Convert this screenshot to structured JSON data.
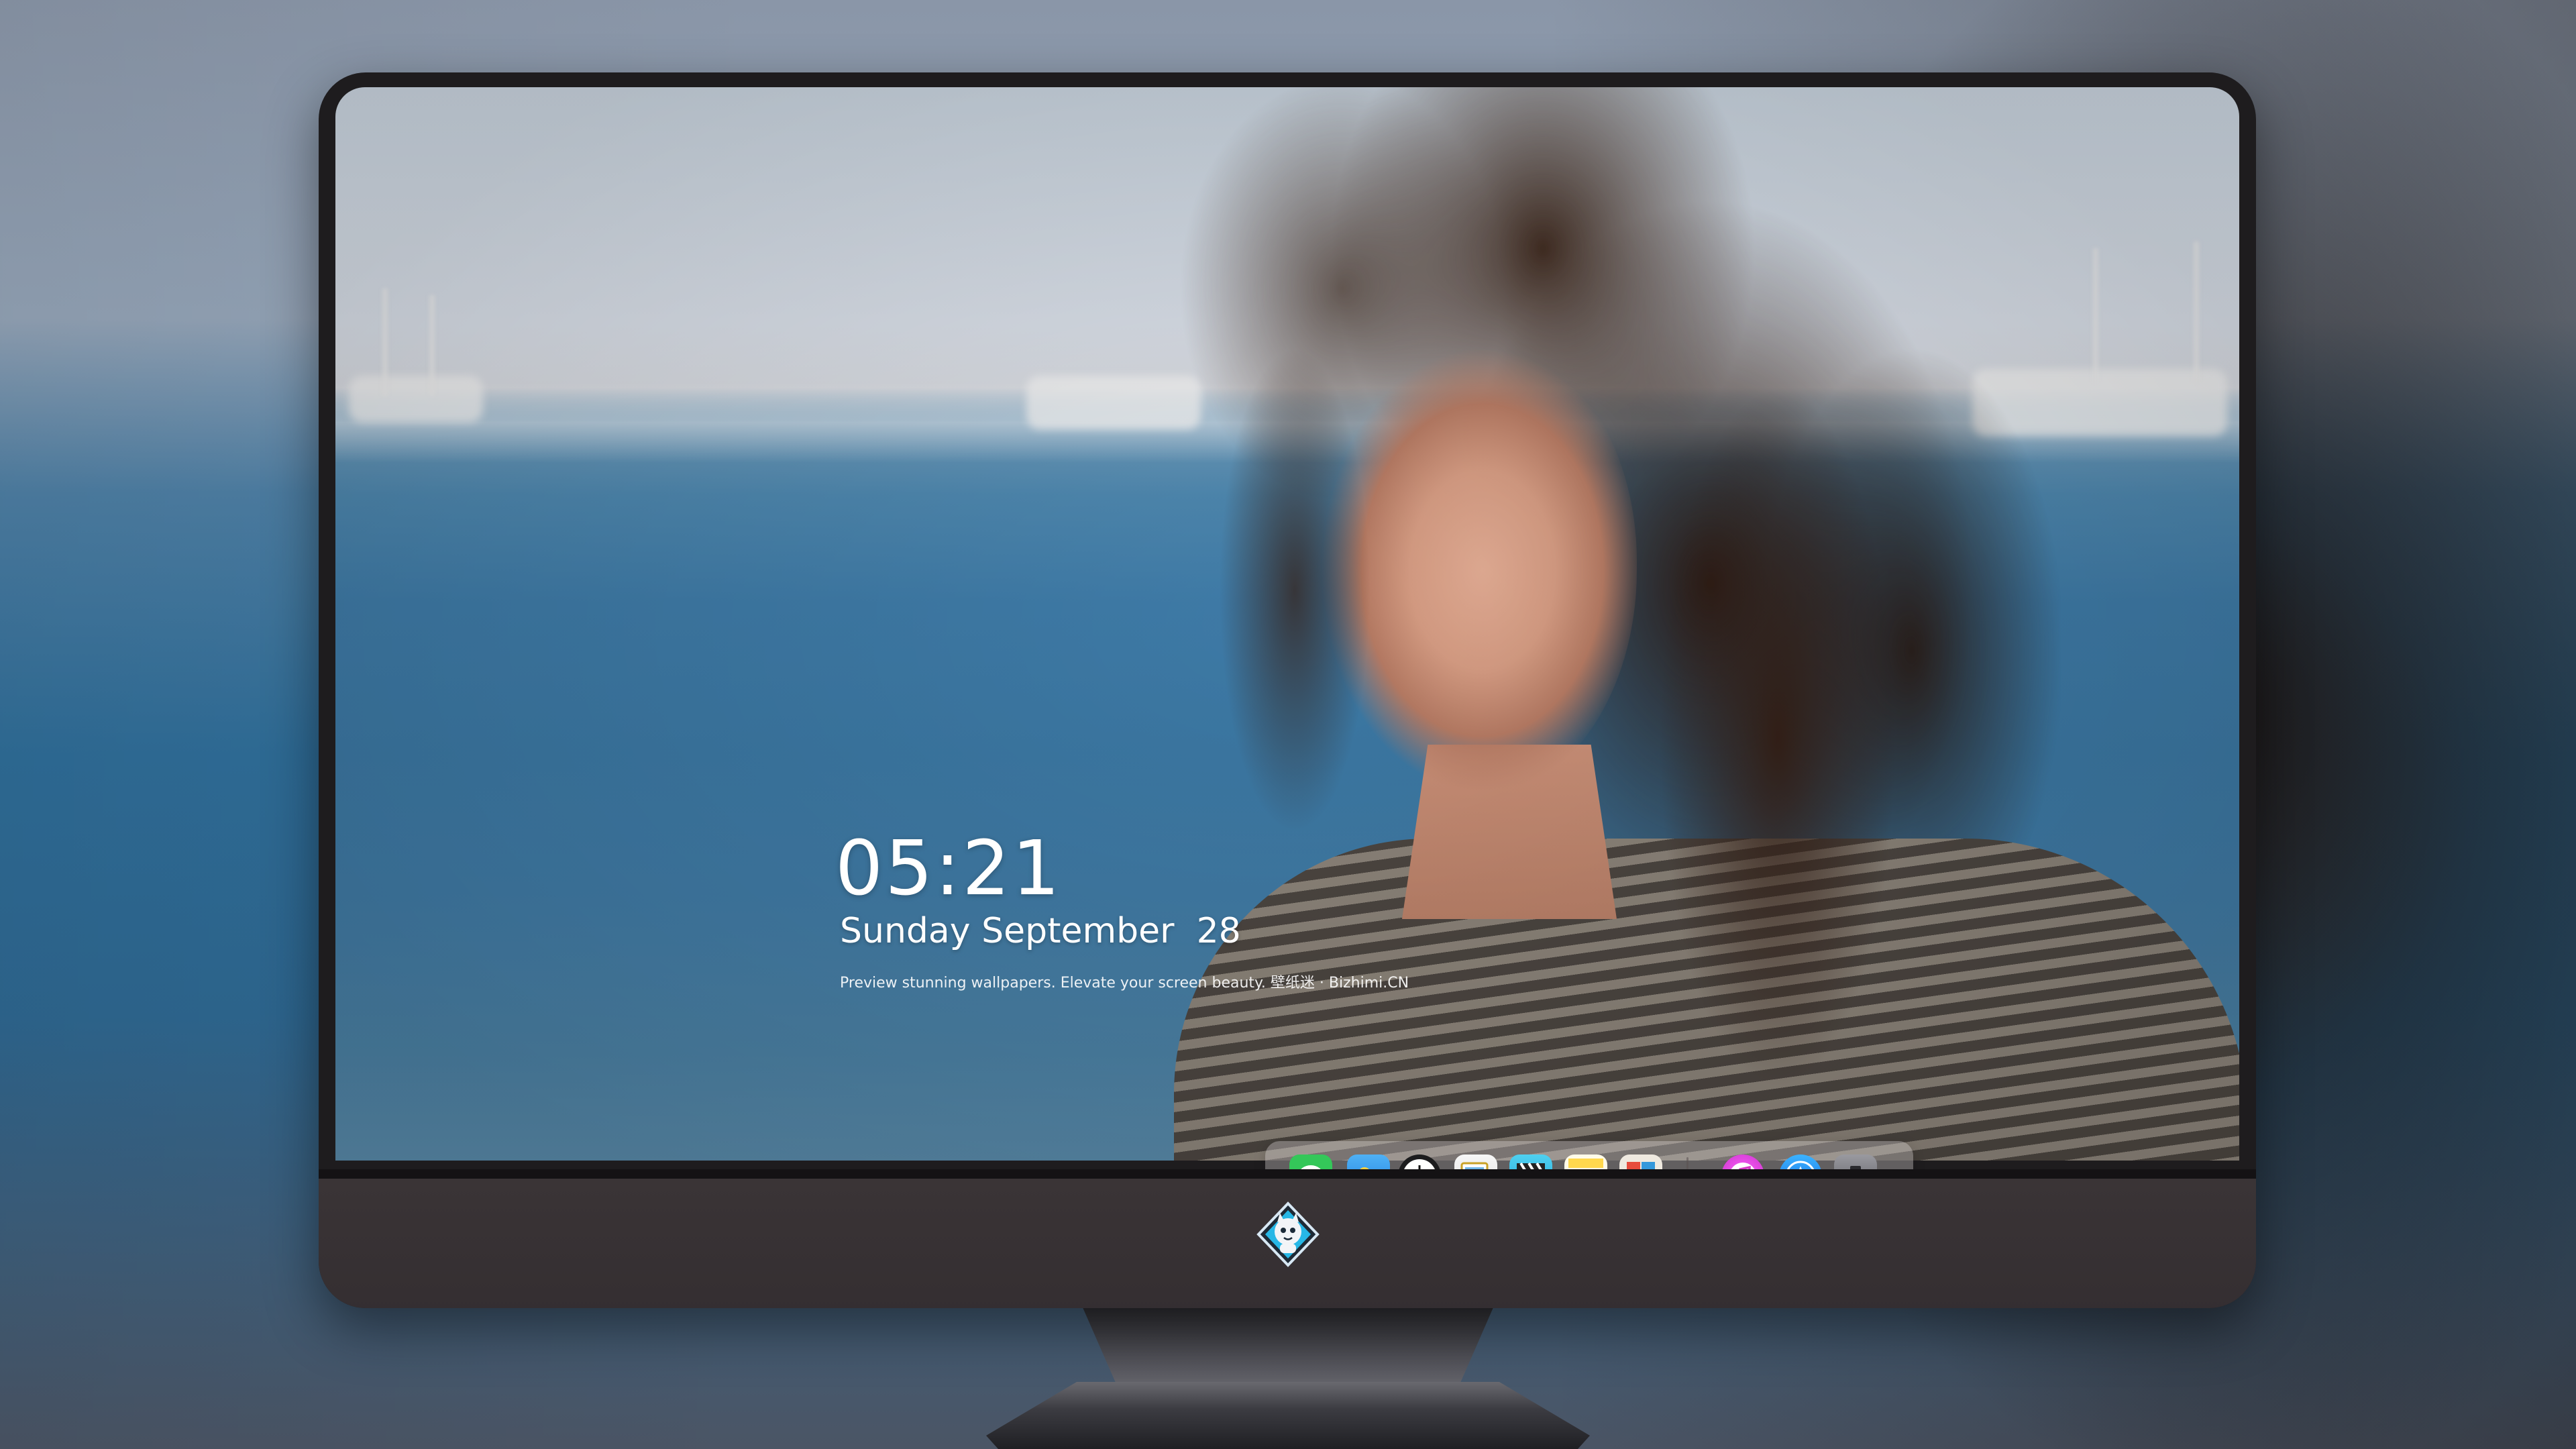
{
  "lock_screen": {
    "time": "05:21",
    "date": "Sunday September  28",
    "tagline": "Preview stunning wallpapers. Elevate your screen beauty. 壁纸迷 · Bizhimi.CN"
  },
  "dock": {
    "apps": [
      {
        "name": "messages-icon",
        "color": "#34c759"
      },
      {
        "name": "weather-icon",
        "color": "#2e8de6"
      },
      {
        "name": "clock-icon",
        "color": "#1c1c1e"
      },
      {
        "name": "preview-icon",
        "color": "#f2c232"
      },
      {
        "name": "clips-icon",
        "color": "#3ac0e8"
      },
      {
        "name": "notes-icon",
        "color": "#ffd84d"
      },
      {
        "name": "photo-booth-icon",
        "color": "#e9e3d8"
      },
      {
        "name": "music-icon",
        "color": "#e63cc8"
      },
      {
        "name": "app-store-icon",
        "color": "#1a8cff"
      },
      {
        "name": "camera-icon",
        "color": "#8e8e93"
      }
    ]
  },
  "monitor": {
    "logo": "mascot-logo-icon"
  }
}
